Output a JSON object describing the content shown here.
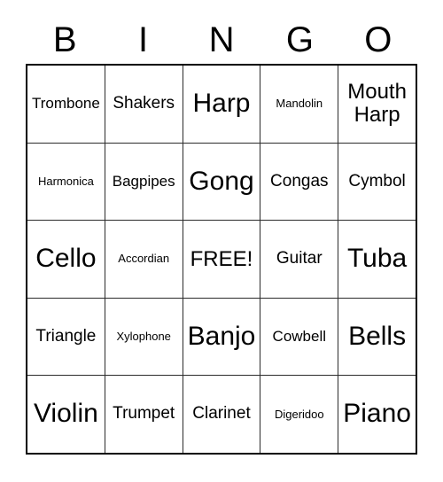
{
  "card": {
    "title": "BINGO",
    "headers": [
      "B",
      "I",
      "N",
      "G",
      "O"
    ],
    "free_space_label": "FREE!",
    "colors": {
      "background": "#ffffff",
      "text": "#000000",
      "outer_border": "#000000",
      "inner_border": "#2b2b2b"
    },
    "rows": [
      [
        {
          "label": "Trombone",
          "size": "sz-s"
        },
        {
          "label": "Shakers",
          "size": "sz-m"
        },
        {
          "label": "Harp",
          "size": "sz-xl"
        },
        {
          "label": "Mandolin",
          "size": "sz-xs"
        },
        {
          "label": "Mouth Harp",
          "size": "sz-l"
        }
      ],
      [
        {
          "label": "Harmonica",
          "size": "sz-xs"
        },
        {
          "label": "Bagpipes",
          "size": "sz-s"
        },
        {
          "label": "Gong",
          "size": "sz-xl"
        },
        {
          "label": "Congas",
          "size": "sz-m"
        },
        {
          "label": "Cymbol",
          "size": "sz-m"
        }
      ],
      [
        {
          "label": "Cello",
          "size": "sz-xl"
        },
        {
          "label": "Accordian",
          "size": "sz-xs"
        },
        {
          "label": "FREE!",
          "size": "sz-l"
        },
        {
          "label": "Guitar",
          "size": "sz-m"
        },
        {
          "label": "Tuba",
          "size": "sz-xl"
        }
      ],
      [
        {
          "label": "Triangle",
          "size": "sz-m"
        },
        {
          "label": "Xylophone",
          "size": "sz-xs"
        },
        {
          "label": "Banjo",
          "size": "sz-xl"
        },
        {
          "label": "Cowbell",
          "size": "sz-s"
        },
        {
          "label": "Bells",
          "size": "sz-xl"
        }
      ],
      [
        {
          "label": "Violin",
          "size": "sz-xl"
        },
        {
          "label": "Trumpet",
          "size": "sz-m"
        },
        {
          "label": "Clarinet",
          "size": "sz-m"
        },
        {
          "label": "Digeridoo",
          "size": "sz-xs"
        },
        {
          "label": "Piano",
          "size": "sz-xl"
        }
      ]
    ]
  }
}
